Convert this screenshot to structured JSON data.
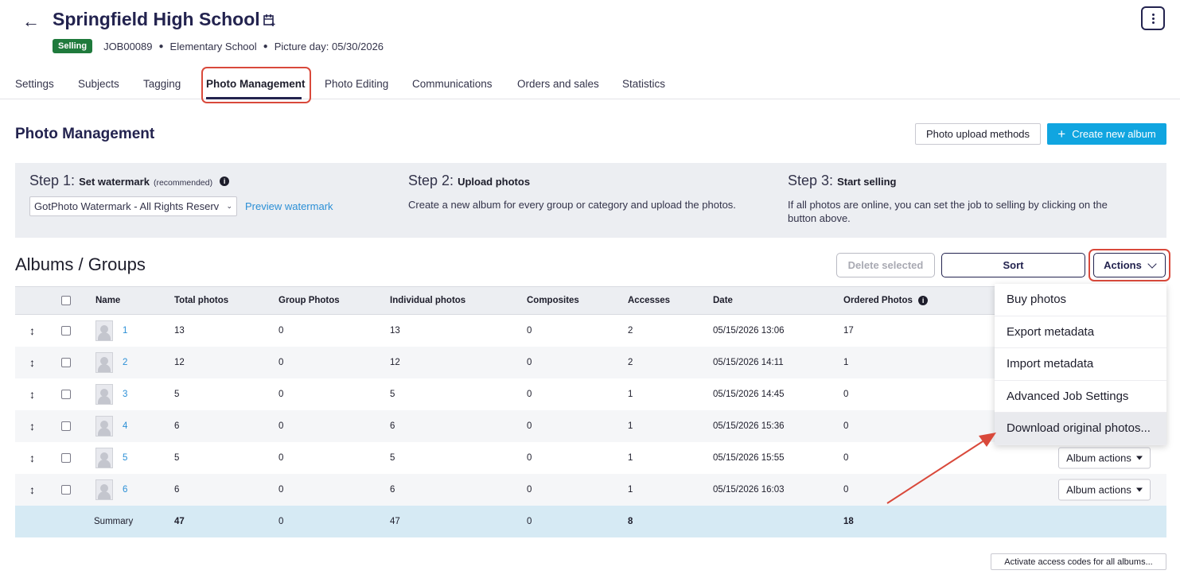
{
  "header": {
    "back_icon": "back-arrow-icon",
    "title": "Springfield High School",
    "calendar_icon": "calendar-icon",
    "more_icon": "more-vertical-icon",
    "status_badge": "Selling",
    "job_id": "JOB00089",
    "school_type": "Elementary School",
    "picture_day": "Picture day: 05/30/2026",
    "badge_color": "#1f7a3c"
  },
  "tabs": [
    {
      "label": "Settings"
    },
    {
      "label": "Subjects"
    },
    {
      "label": "Tagging"
    },
    {
      "label": "Photo Management"
    },
    {
      "label": "Photo Editing"
    },
    {
      "label": "Communications"
    },
    {
      "label": "Orders and sales"
    },
    {
      "label": "Statistics"
    }
  ],
  "section": {
    "title": "Photo Management",
    "upload_methods_label": "Photo upload methods",
    "create_album_label": "Create new album",
    "accent_color": "#10a5e0"
  },
  "steps": {
    "step1_prefix": "Step 1:",
    "step1_title": "Set watermark",
    "step1_note": "(recommended)",
    "watermark_value": "GotPhoto Watermark - All Rights Reserv",
    "preview_link": "Preview watermark",
    "step2_prefix": "Step 2:",
    "step2_title": "Upload photos",
    "step2_text": "Create a new album for every group or category and upload the photos.",
    "step3_prefix": "Step 3:",
    "step3_title": "Start selling",
    "step3_text": "If all photos are online, you can set the job to selling by clicking on the button above."
  },
  "albums": {
    "title": "Albums / Groups",
    "delete_label": "Delete selected",
    "sort_label": "Sort",
    "actions_label": "Actions",
    "columns": [
      "Name",
      "Total photos",
      "Group Photos",
      "Individual photos",
      "Composites",
      "Accesses",
      "Date",
      "Ordered Photos"
    ],
    "rows": [
      {
        "name": "1",
        "total": "13",
        "group": "0",
        "individual": "13",
        "composites": "0",
        "accesses": "2",
        "date": "05/15/2026 13:06",
        "ordered": "17"
      },
      {
        "name": "2",
        "total": "12",
        "group": "0",
        "individual": "12",
        "composites": "0",
        "accesses": "2",
        "date": "05/15/2026 14:11",
        "ordered": "1"
      },
      {
        "name": "3",
        "total": "5",
        "group": "0",
        "individual": "5",
        "composites": "0",
        "accesses": "1",
        "date": "05/15/2026 14:45",
        "ordered": "0"
      },
      {
        "name": "4",
        "total": "6",
        "group": "0",
        "individual": "6",
        "composites": "0",
        "accesses": "1",
        "date": "05/15/2026 15:36",
        "ordered": "0"
      },
      {
        "name": "5",
        "total": "5",
        "group": "0",
        "individual": "5",
        "composites": "0",
        "accesses": "1",
        "date": "05/15/2026 15:55",
        "ordered": "0",
        "action": "Album actions"
      },
      {
        "name": "6",
        "total": "6",
        "group": "0",
        "individual": "6",
        "composites": "0",
        "accesses": "1",
        "date": "05/15/2026 16:03",
        "ordered": "0",
        "action": "Album actions"
      }
    ],
    "summary": {
      "label": "Summary",
      "total": "47",
      "group": "0",
      "individual": "47",
      "composites": "0",
      "accesses": "8",
      "ordered": "18"
    }
  },
  "actions_menu": {
    "items": [
      {
        "label": "Buy photos"
      },
      {
        "label": "Export metadata"
      },
      {
        "label": "Import metadata"
      },
      {
        "label": "Advanced Job Settings"
      },
      {
        "label": "Download original photos..."
      }
    ]
  },
  "footer": {
    "activate_label": "Activate access codes for all albums..."
  },
  "annotation_color": "#d9493b"
}
